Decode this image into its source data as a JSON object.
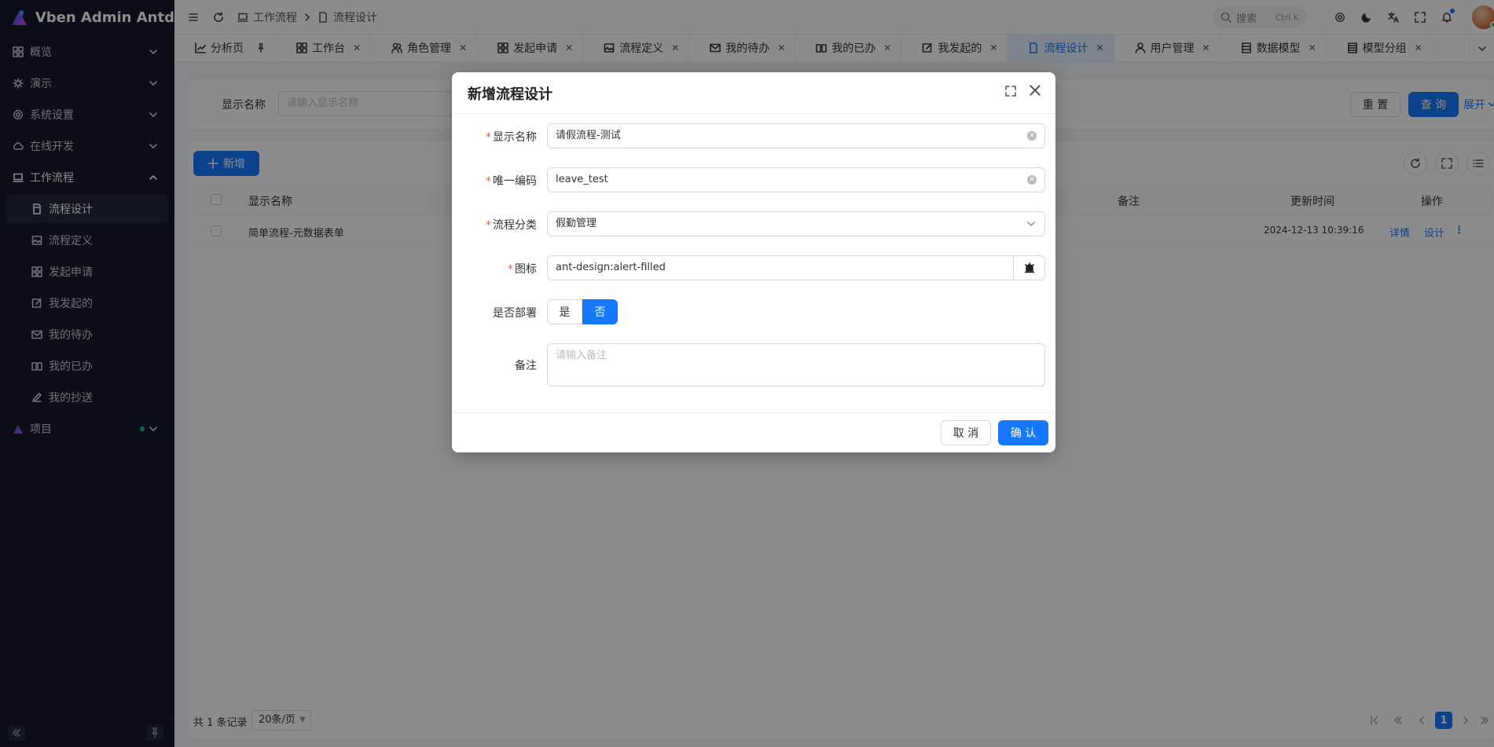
{
  "app": {
    "title": "Vben Admin Antd"
  },
  "colors": {
    "primary": "#1677ff",
    "sidebar_bg": "#141a28",
    "danger": "#ff4d4f"
  },
  "sidebar": {
    "items": [
      {
        "label": "概览",
        "icon": "grid-icon"
      },
      {
        "label": "演示",
        "icon": "bug-icon"
      },
      {
        "label": "系统设置",
        "icon": "gear-icon"
      },
      {
        "label": "在线开发",
        "icon": "cloud-icon"
      },
      {
        "label": "工作流程",
        "icon": "laptop-icon"
      }
    ],
    "sub_items": [
      {
        "label": "流程设计",
        "icon": "document-icon"
      },
      {
        "label": "流程定义",
        "icon": "image-icon"
      },
      {
        "label": "发起申请",
        "icon": "grid-icon"
      },
      {
        "label": "我发起的",
        "icon": "edit-icon"
      },
      {
        "label": "我的待办",
        "icon": "mail-icon"
      },
      {
        "label": "我的已办",
        "icon": "book-icon"
      },
      {
        "label": "我的抄送",
        "icon": "pen-icon"
      }
    ],
    "project": {
      "label": "项目"
    }
  },
  "header": {
    "breadcrumb": [
      "工作流程",
      "流程设计"
    ],
    "search_placeholder": "搜索",
    "search_kbd": "Ctrl K"
  },
  "tabs": [
    {
      "label": "分析页"
    },
    {
      "label": "工作台"
    },
    {
      "label": "角色管理"
    },
    {
      "label": "发起申请"
    },
    {
      "label": "流程定义"
    },
    {
      "label": "我的待办"
    },
    {
      "label": "我的已办"
    },
    {
      "label": "我发起的"
    },
    {
      "label": "流程设计"
    },
    {
      "label": "用户管理"
    },
    {
      "label": "数据模型"
    },
    {
      "label": "模型分组"
    }
  ],
  "filter": {
    "label": "显示名称",
    "placeholder": "请输入显示名称",
    "reset": "重 置",
    "query": "查 询",
    "expand": "展开"
  },
  "table": {
    "add_button": "新增",
    "columns": {
      "name": "显示名称",
      "remark": "备注",
      "updated": "更新时间",
      "actions": "操作"
    },
    "rows": [
      {
        "name": "简单流程-元数据表单",
        "updated": "2024-12-13 10:39:16",
        "detail": "详情",
        "design": "设计"
      }
    ],
    "total": "共 1 条记录",
    "page_size": "20条/页",
    "page": "1"
  },
  "modal": {
    "title": "新增流程设计",
    "fields": {
      "display_name": {
        "label": "显示名称",
        "value": "请假流程-测试"
      },
      "code": {
        "label": "唯一编码",
        "value": "leave_test"
      },
      "category": {
        "label": "流程分类",
        "value": "假勤管理"
      },
      "icon": {
        "label": "图标",
        "value": "ant-design:alert-filled"
      },
      "deploy": {
        "label": "是否部署",
        "yes": "是",
        "no": "否"
      },
      "remark": {
        "label": "备注",
        "placeholder": "请输入备注"
      }
    },
    "cancel": "取 消",
    "confirm": "确 认"
  }
}
